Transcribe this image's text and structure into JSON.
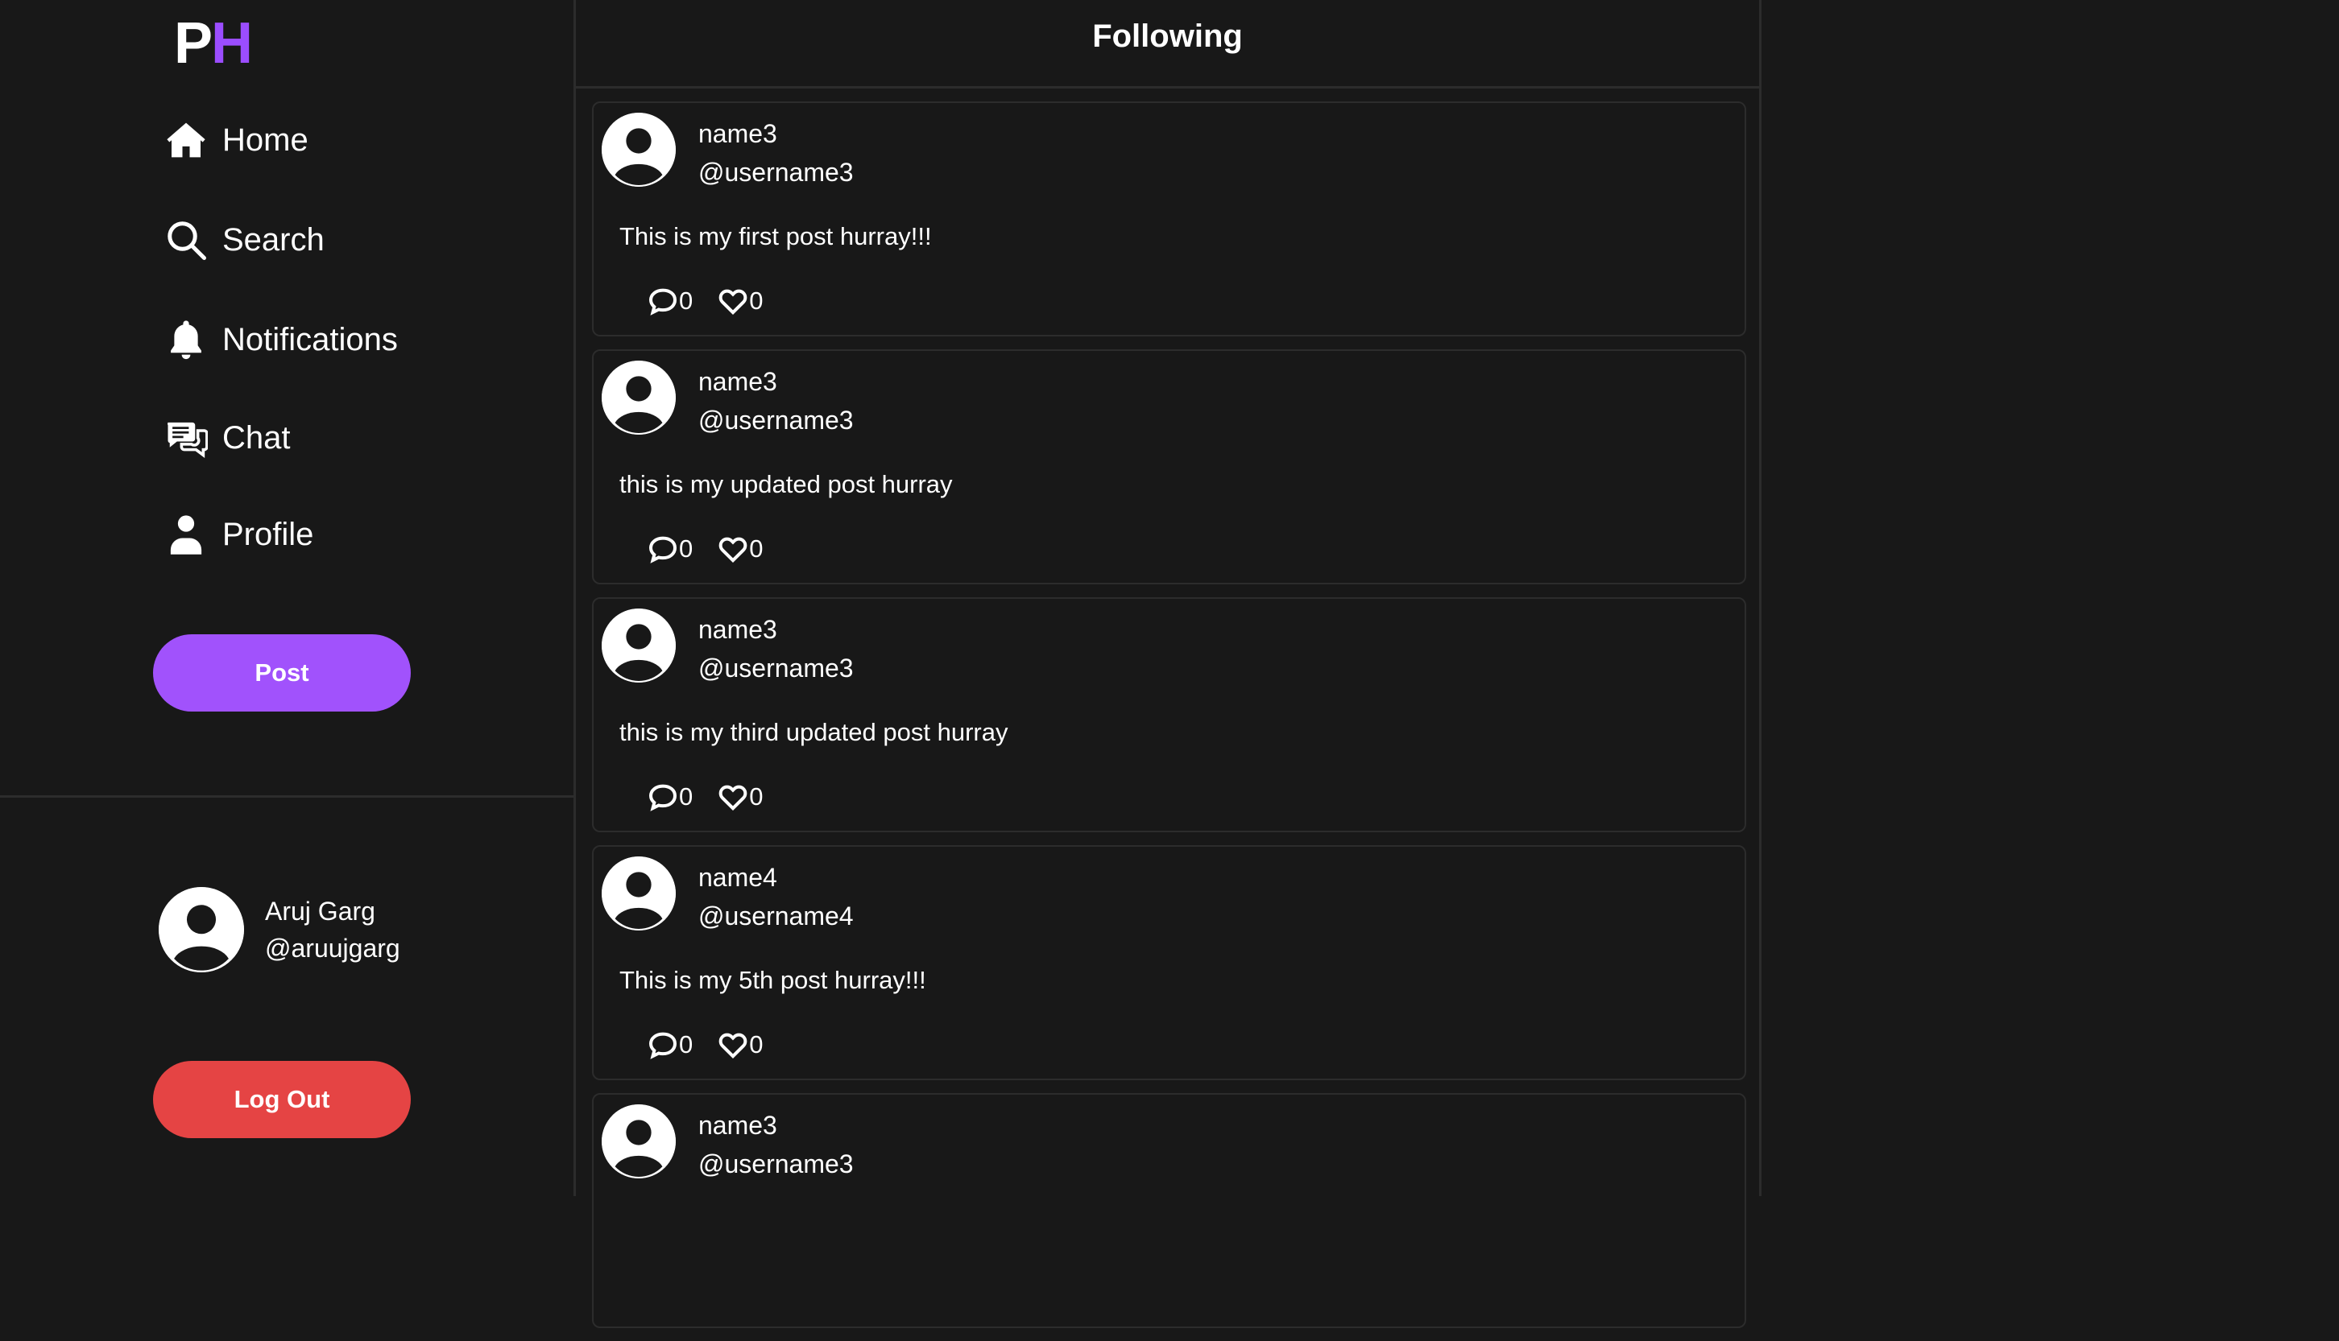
{
  "logo": {
    "first": "P",
    "second": "H"
  },
  "nav": [
    {
      "label": "Home",
      "icon": "home-icon"
    },
    {
      "label": "Search",
      "icon": "search-icon"
    },
    {
      "label": "Notifications",
      "icon": "bell-icon"
    },
    {
      "label": "Chat",
      "icon": "chat-icon"
    },
    {
      "label": "Profile",
      "icon": "user-icon"
    }
  ],
  "post_button": "Post",
  "current_user": {
    "name": "Aruj Garg",
    "handle": "@aruujgarg"
  },
  "logout_button": "Log Out",
  "header": {
    "title": "Following"
  },
  "colors": {
    "background": "#181818",
    "accent": "#a152fc",
    "logo_h": "#9b4dff",
    "danger": "#e54444",
    "border": "#2c2c2c"
  },
  "posts": [
    {
      "name": "name3",
      "handle": "@username3",
      "text": "This is my first post hurray!!!",
      "comments": "0",
      "likes": "0"
    },
    {
      "name": "name3",
      "handle": "@username3",
      "text": "this is my updated post hurray",
      "comments": "0",
      "likes": "0"
    },
    {
      "name": "name3",
      "handle": "@username3",
      "text": "this is my third updated post hurray",
      "comments": "0",
      "likes": "0"
    },
    {
      "name": "name4",
      "handle": "@username4",
      "text": "This is my 5th post hurray!!!",
      "comments": "0",
      "likes": "0"
    },
    {
      "name": "name3",
      "handle": "@username3",
      "text": "",
      "comments": "",
      "likes": ""
    }
  ]
}
